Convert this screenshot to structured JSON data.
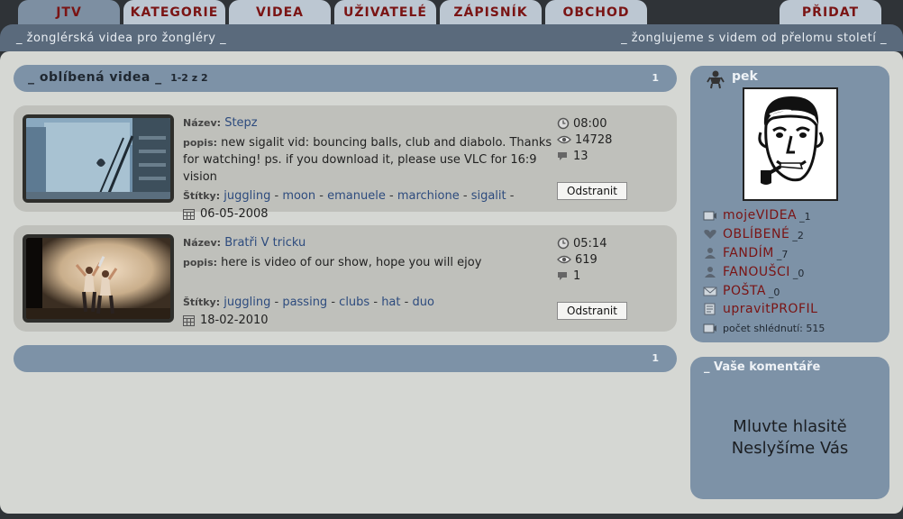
{
  "tabs": [
    "JTV",
    "KATEGORIE",
    "VIDEA",
    "UŽIVATELÉ",
    "ZÁPISNÍK",
    "OBCHOD"
  ],
  "tab_right": "PŘIDAT",
  "strip": {
    "left": "_ žonglérská videa pro žongléry _",
    "right": "_ žonglujeme s videm od přelomu století _"
  },
  "favorites": {
    "title": "_ oblíbená videa _",
    "count": "1-2 z 2",
    "page": "1",
    "page_bottom": "1"
  },
  "labels": {
    "name": "Název:",
    "desc": "popis:",
    "tags": "Štítky:",
    "remove": "Odstranit"
  },
  "videos": [
    {
      "title": "Stepz",
      "description": "new sigalit vid: bouncing balls, club and diabolo. Thanks for watching! ps. if you download it, please use VLC for 16:9 vision",
      "tags": [
        "juggling",
        "moon",
        "emanuele",
        "marchione",
        "sigalit"
      ],
      "tags_trailing_sep": "-",
      "date": "06-05-2008",
      "duration": "08:00",
      "views": "14728",
      "comments": "13"
    },
    {
      "title": "Bratři V tricku",
      "description": "here is video of our show, hope you will ejoy",
      "tags": [
        "juggling",
        "passing",
        "clubs",
        "hat",
        "duo"
      ],
      "tags_trailing_sep": "",
      "date": "18-02-2010",
      "duration": "05:14",
      "views": "619",
      "comments": "1"
    }
  ],
  "profile": {
    "username": "pek",
    "menu": [
      {
        "label": "mojeVIDEA",
        "count": "_1",
        "icon": "video-icon"
      },
      {
        "label": "OBLÍBENÉ",
        "count": "_2",
        "icon": "heart-icon"
      },
      {
        "label": "FANDÍM",
        "count": "_7",
        "icon": "person-icon"
      },
      {
        "label": "FANOUŠCI",
        "count": "_0",
        "icon": "fans-icon"
      },
      {
        "label": "POŠTA",
        "count": "_0",
        "icon": "mail-icon"
      },
      {
        "label": "upravitPROFIL",
        "count": "",
        "icon": "edit-icon"
      }
    ],
    "views_label": "počet shlédnutí: 515"
  },
  "comments": {
    "title": "_ Vaše komentáře",
    "line1": "Mluvte hlasitě",
    "line2": "Neslyšíme Vás"
  },
  "colors": {
    "tab_bg": "#bcc7d2",
    "tab_active_bg": "#7d8fa2",
    "brand_red": "#7a1414",
    "panel_blue": "#7d92a7",
    "link_blue": "#2d4b7e"
  }
}
